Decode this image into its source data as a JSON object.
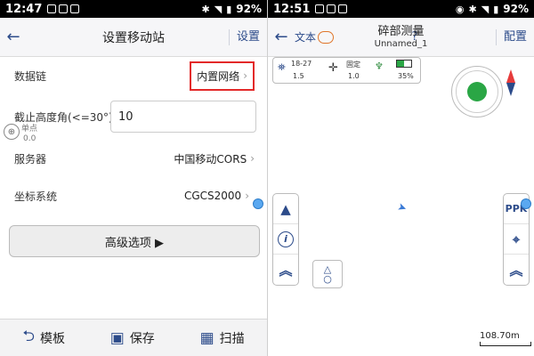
{
  "left": {
    "status": {
      "time": "12:47",
      "battery": "92%"
    },
    "header": {
      "title": "设置移动站",
      "action": "设置"
    },
    "rows": {
      "datalink": {
        "label": "数据链",
        "value": "内置网络"
      },
      "cutoff": {
        "label": "截止高度角(<=30°)",
        "value": "10"
      },
      "server": {
        "label": "服务器",
        "value": "中国移动CORS"
      },
      "coord": {
        "label": "坐标系统",
        "value": "CGCS2000"
      }
    },
    "point_widget": {
      "label": "单点",
      "value": "0.0"
    },
    "advanced_button": "高级选项 ▶",
    "bottom": {
      "template": "模板",
      "save": "保存",
      "scan": "扫描"
    }
  },
  "right": {
    "status": {
      "time": "12:51",
      "battery": "92%"
    },
    "header": {
      "text_label": "文本",
      "title": "碎部测量",
      "subtitle": "Unnamed_1",
      "help": "?",
      "config": "配置"
    },
    "info": {
      "sats": "18-27",
      "sats_sub": "1.5",
      "fix": "固定",
      "fix_sub": "1.0",
      "battery": "35%"
    },
    "ppk": "PPK",
    "scale": "108.70m"
  }
}
